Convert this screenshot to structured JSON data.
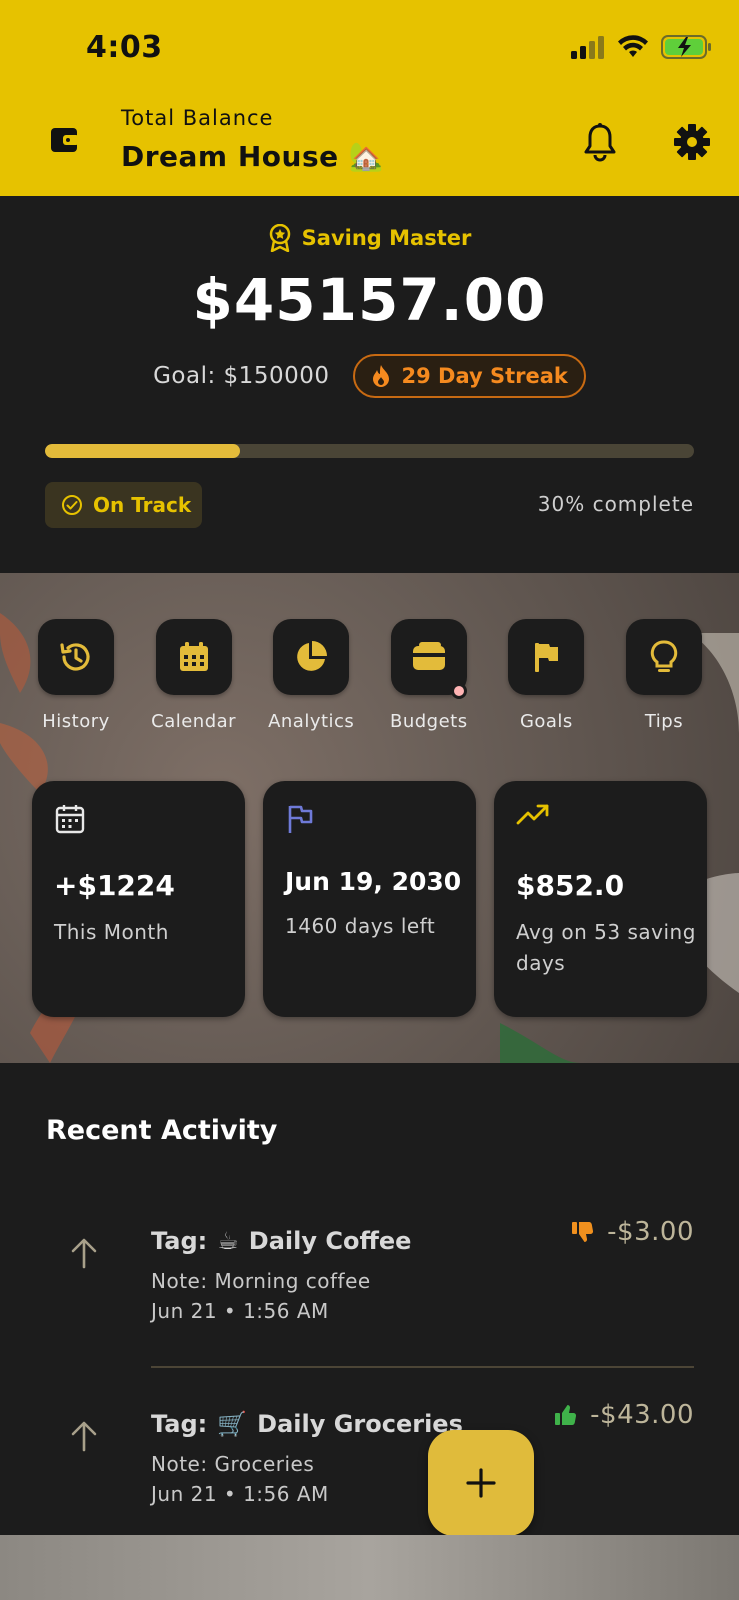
{
  "status_bar": {
    "time": "4:03"
  },
  "header": {
    "subtitle": "Total Balance",
    "title": "Dream House 🏡"
  },
  "summary": {
    "badge": "Saving Master",
    "balance": "$45157.00",
    "goal": "Goal: $150000",
    "streak": "29 Day Streak",
    "progress_fraction": 0.3,
    "status": "On Track",
    "percent_text": "30% complete"
  },
  "quick_actions": [
    {
      "label": "History",
      "icon": "history-icon"
    },
    {
      "label": "Calendar",
      "icon": "calendar-icon"
    },
    {
      "label": "Analytics",
      "icon": "pie-chart-icon"
    },
    {
      "label": "Budgets",
      "icon": "wallet-icon"
    },
    {
      "label": "Goals",
      "icon": "flag-icon"
    },
    {
      "label": "Tips",
      "icon": "lightbulb-icon"
    }
  ],
  "stats": [
    {
      "value": "+$1224",
      "label": "This Month",
      "icon": "calendar-icon"
    },
    {
      "value": "Jun 19, 2030",
      "label": "1460 days left",
      "icon": "flag-icon"
    },
    {
      "value": "$852.0",
      "label": "Avg on 53 saving days",
      "icon": "trending-up-icon"
    }
  ],
  "activity": {
    "title": "Recent Activity",
    "items": [
      {
        "tag_prefix": "Tag:",
        "emoji": "☕",
        "tag": "Daily Coffee",
        "note": "Note: Morning coffee",
        "date": "Jun 21 • 1:56 AM",
        "amount": "-$3.00",
        "rating": "thumbs-down"
      },
      {
        "tag_prefix": "Tag:",
        "emoji": "🛒",
        "tag": "Daily Groceries",
        "note": "Note: Groceries",
        "date": "Jun 21 • 1:56 AM",
        "amount": "-$43.00",
        "rating": "thumbs-up"
      }
    ]
  },
  "fab": {
    "label": "+"
  },
  "colors": {
    "accent": "#e6c200",
    "background": "#1c1c1c",
    "streak_orange": "#f58a1f",
    "thumbs_down": "#f0901e",
    "thumbs_up": "#3fb24a"
  }
}
